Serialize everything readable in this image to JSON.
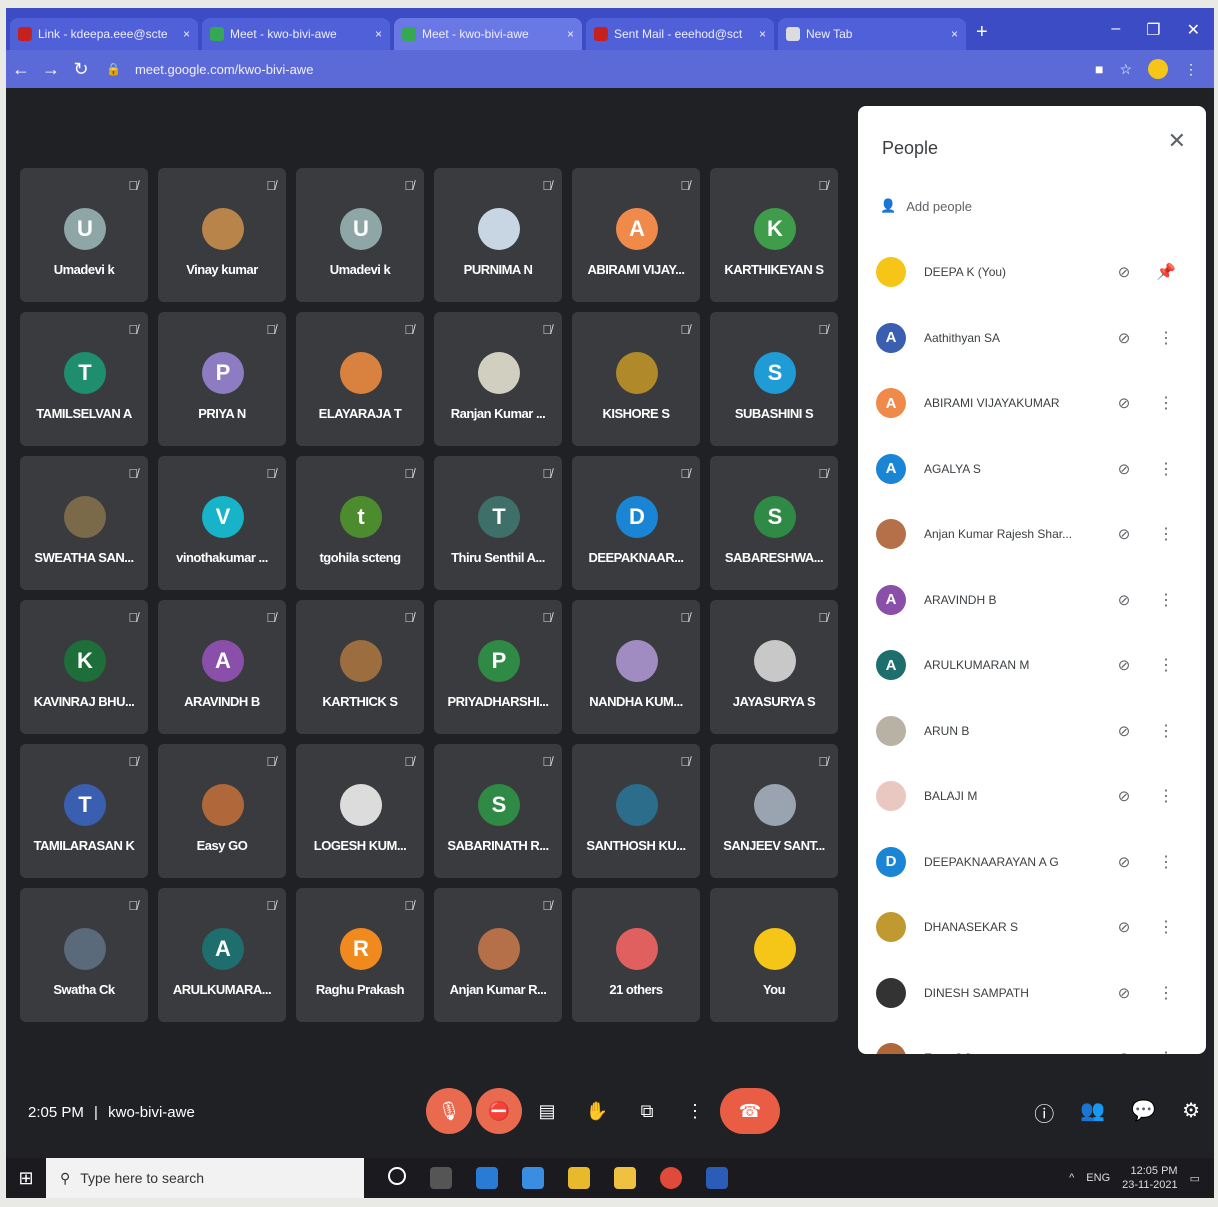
{
  "browser": {
    "tabs": [
      {
        "label": "Link - kdeepa.eee@scte",
        "close": "×",
        "icon_color": "#c5221f"
      },
      {
        "label": "Meet - kwo-bivi-awe",
        "close": "×",
        "icon_color": "#34a853"
      },
      {
        "label": "Meet - kwo-bivi-awe",
        "close": "×",
        "icon_color": "#34a853"
      },
      {
        "label": "Sent Mail - eeehod@sct",
        "close": "×",
        "icon_color": "#c5221f"
      },
      {
        "label": "New Tab",
        "close": "×",
        "icon_color": "#dadce0"
      }
    ],
    "new_tab": "+",
    "url": "meet.google.com/kwo-bivi-awe"
  },
  "tiles": [
    {
      "name": "Umadevi k",
      "initial": "U",
      "color": "#8fa6a6"
    },
    {
      "name": "Vinay kumar",
      "initial": "",
      "color": "#b9844a"
    },
    {
      "name": "Umadevi k",
      "initial": "U",
      "color": "#8fa6a6"
    },
    {
      "name": "PURNIMA N",
      "initial": "",
      "color": "#c8d6e4"
    },
    {
      "name": "ABIRAMI VIJAY...",
      "initial": "A",
      "color": "#f08a4b"
    },
    {
      "name": "KARTHIKEYAN S",
      "initial": "K",
      "color": "#3f9c4a"
    },
    {
      "name": "TAMILSELVAN A",
      "initial": "T",
      "color": "#1e8e6e"
    },
    {
      "name": "PRIYA N",
      "initial": "P",
      "color": "#8e7cc3"
    },
    {
      "name": "ELAYARAJA T",
      "initial": "",
      "color": "#d9823f"
    },
    {
      "name": "Ranjan Kumar ...",
      "initial": "",
      "color": "#d0cfc0"
    },
    {
      "name": "KISHORE S",
      "initial": "",
      "color": "#b08a2a"
    },
    {
      "name": "SUBASHINI S",
      "initial": "S",
      "color": "#1f9bd6"
    },
    {
      "name": "SWEATHA SAN...",
      "initial": "",
      "color": "#7a6a4a"
    },
    {
      "name": "vinothakumar ...",
      "initial": "V",
      "color": "#17b3c8"
    },
    {
      "name": "tgohila scteng",
      "initial": "t",
      "color": "#4c8c2f"
    },
    {
      "name": "Thiru Senthil A...",
      "initial": "T",
      "color": "#3e6f68"
    },
    {
      "name": "DEEPAKNAAR...",
      "initial": "D",
      "color": "#1a85d4"
    },
    {
      "name": "SABARESHWA...",
      "initial": "S",
      "color": "#2f8a45"
    },
    {
      "name": "KAVINRAJ BHU...",
      "initial": "K",
      "color": "#1e6e3a"
    },
    {
      "name": "ARAVINDH B",
      "initial": "A",
      "color": "#8a4fa8"
    },
    {
      "name": "KARTHICK S",
      "initial": "",
      "color": "#9c6d3e"
    },
    {
      "name": "PRIYADHARSHI...",
      "initial": "P",
      "color": "#2f8a45"
    },
    {
      "name": "NANDHA KUM...",
      "initial": "",
      "color": "#a08cc0"
    },
    {
      "name": "JAYASURYA S",
      "initial": "",
      "color": "#c8c8c8"
    },
    {
      "name": "TAMILARASAN K",
      "initial": "T",
      "color": "#3a5fb0"
    },
    {
      "name": "Easy GO",
      "initial": "",
      "color": "#b0683a"
    },
    {
      "name": "LOGESH KUM...",
      "initial": "",
      "color": "#dcdcdc"
    },
    {
      "name": "SABARINATH R...",
      "initial": "S",
      "color": "#2f8a45"
    },
    {
      "name": "SANTHOSH KU...",
      "initial": "",
      "color": "#2c6d8c"
    },
    {
      "name": "SANJEEV SANT...",
      "initial": "",
      "color": "#9aa4b0"
    },
    {
      "name": "Swatha Ck",
      "initial": "",
      "color": "#5a6a7a"
    },
    {
      "name": "ARULKUMARA...",
      "initial": "A",
      "color": "#1e6e6e"
    },
    {
      "name": "Raghu Prakash",
      "initial": "R",
      "color": "#f08a1e"
    },
    {
      "name": "Anjan Kumar R...",
      "initial": "",
      "color": "#b5704a"
    },
    {
      "name": "21 others",
      "initial": "",
      "color": "#e06060"
    },
    {
      "name": "You",
      "initial": "",
      "color": "#f5c518"
    }
  ],
  "people_panel": {
    "title": "People",
    "add_people": "Add people",
    "participants": [
      {
        "name": "DEEPA K (You)",
        "initial": "",
        "color": "#f5c518"
      },
      {
        "name": "Aathithyan SA",
        "initial": "A",
        "color": "#3a5fb0"
      },
      {
        "name": "ABIRAMI VIJAYAKUMAR",
        "initial": "A",
        "color": "#f08a4b"
      },
      {
        "name": "AGALYA S",
        "initial": "A",
        "color": "#1a85d4"
      },
      {
        "name": "Anjan Kumar Rajesh Shar...",
        "initial": "",
        "color": "#b5704a"
      },
      {
        "name": "ARAVINDH B",
        "initial": "A",
        "color": "#8a4fa8"
      },
      {
        "name": "ARULKUMARAN M",
        "initial": "A",
        "color": "#1e6e6e"
      },
      {
        "name": "ARUN B",
        "initial": "",
        "color": "#b8b2a4"
      },
      {
        "name": "BALAJI M",
        "initial": "",
        "color": "#e8c8c0"
      },
      {
        "name": "DEEPAKNAARAYAN A G",
        "initial": "D",
        "color": "#1a85d4"
      },
      {
        "name": "DHANASEKAR S",
        "initial": "",
        "color": "#c09a30"
      },
      {
        "name": "DINESH SAMPATH",
        "initial": "",
        "color": "#333333"
      },
      {
        "name": "Easy GO",
        "initial": "",
        "color": "#b0683a"
      }
    ]
  },
  "bottom": {
    "time": "2:05 PM",
    "separator": "|",
    "meeting_code": "kwo-bivi-awe"
  },
  "taskbar": {
    "search_placeholder": "Type here to search",
    "time": "12:05 PM",
    "date": "23-11-2021",
    "lang": "ENG"
  }
}
